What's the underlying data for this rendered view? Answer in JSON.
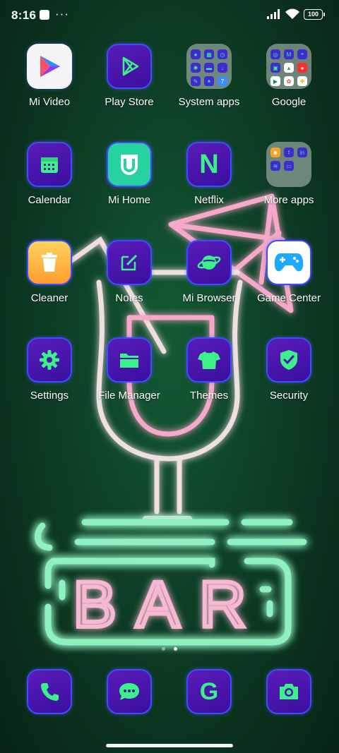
{
  "status": {
    "time": "8:16",
    "battery": "100"
  },
  "apps": [
    {
      "label": "Mi Video",
      "icon": "mi-video-icon"
    },
    {
      "label": "Play Store",
      "icon": "play-store-icon"
    },
    {
      "label": "System apps",
      "icon": "folder-icon"
    },
    {
      "label": "Google",
      "icon": "folder-icon"
    },
    {
      "label": "Calendar",
      "icon": "calendar-icon"
    },
    {
      "label": "Mi Home",
      "icon": "mi-home-icon"
    },
    {
      "label": "Netflix",
      "icon": "netflix-icon"
    },
    {
      "label": "More apps",
      "icon": "folder-icon"
    },
    {
      "label": "Cleaner",
      "icon": "cleaner-icon"
    },
    {
      "label": "Notes",
      "icon": "notes-icon"
    },
    {
      "label": "Mi Browser",
      "icon": "browser-icon"
    },
    {
      "label": "Game Center",
      "icon": "gamepad-icon"
    },
    {
      "label": "Settings",
      "icon": "gear-icon"
    },
    {
      "label": "File Manager",
      "icon": "folder-icon"
    },
    {
      "label": "Themes",
      "icon": "tshirt-icon"
    },
    {
      "label": "Security",
      "icon": "shield-icon"
    }
  ],
  "netflix_letter": "N",
  "google_letter": "G",
  "wallpaper_sign": "BAR",
  "dock": [
    {
      "name": "phone",
      "icon": "phone-icon"
    },
    {
      "name": "messages",
      "icon": "chat-icon"
    },
    {
      "name": "google",
      "icon": "google-icon"
    },
    {
      "name": "camera",
      "icon": "camera-icon"
    }
  ],
  "colors": {
    "icon_green": "#3cf08a",
    "icon_bg": "#4a14b0",
    "neon_green": "#5ee8a8",
    "neon_pink": "#f5a8c8"
  }
}
